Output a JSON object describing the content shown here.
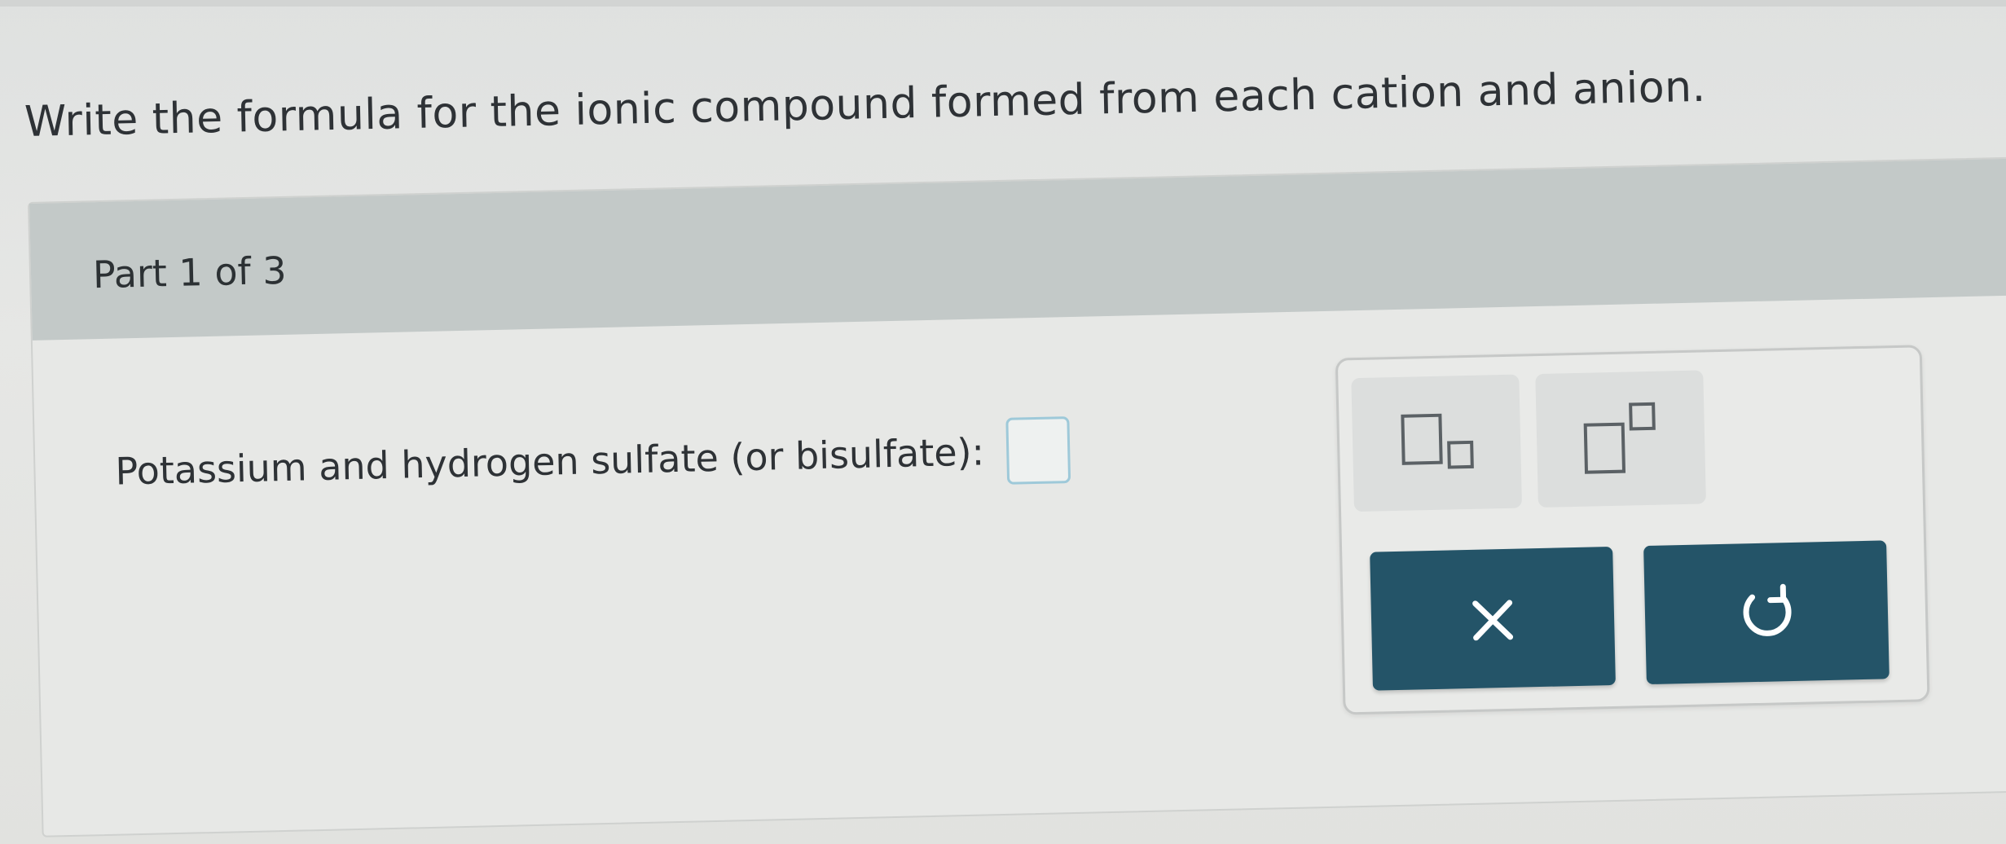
{
  "question": {
    "text": "Write the formula for the ionic compound formed from each cation and anion."
  },
  "part": {
    "label": "Part 1 of 3",
    "prompt": "Potassium and hydrogen sulfate (or bisulfate):",
    "answer_value": ""
  },
  "palette": {
    "tools": [
      {
        "icon": "subscript-icon"
      },
      {
        "icon": "superscript-icon"
      }
    ],
    "actions": [
      {
        "icon": "close-icon",
        "label": "×"
      },
      {
        "icon": "undo-icon"
      }
    ]
  },
  "colors": {
    "action_button_bg": "#245468",
    "header_bg": "#c3c9c8",
    "answer_box_border": "#9ec9d9",
    "page_bg": "#e4e5e3"
  }
}
